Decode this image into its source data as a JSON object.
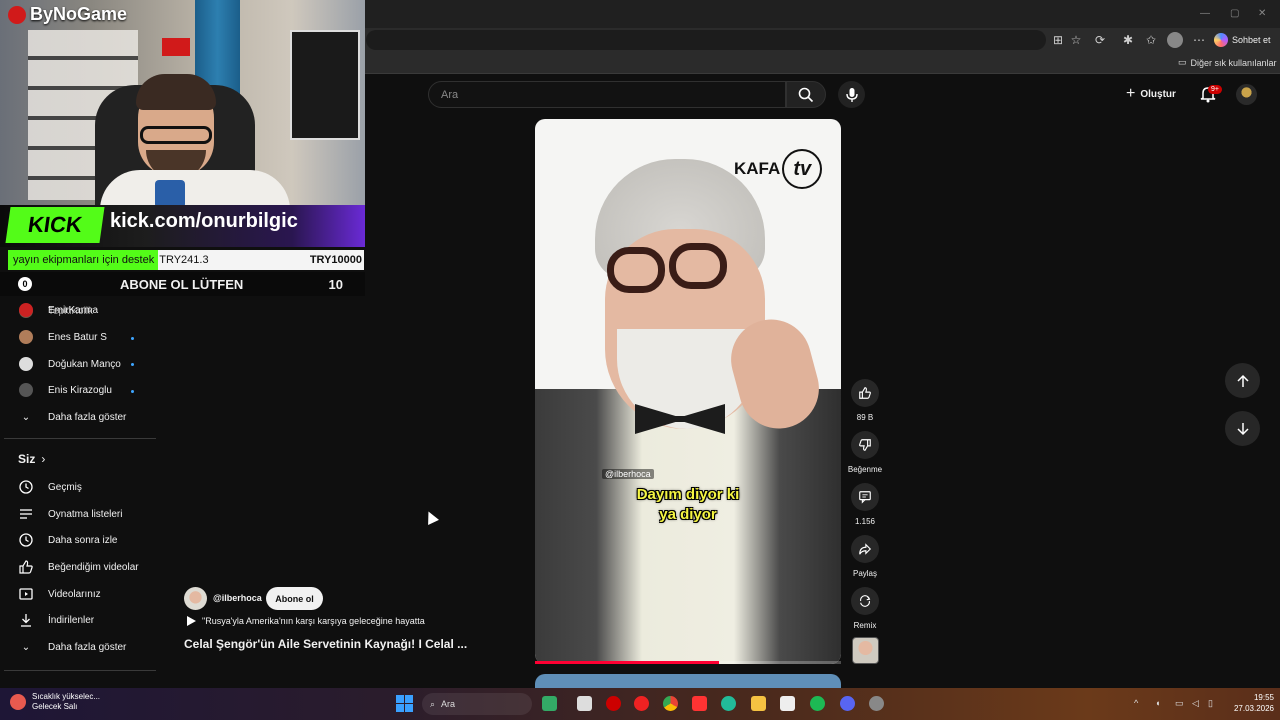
{
  "browser": {
    "sohbet_label": "Sohbet et",
    "other_bookmarks": "Diğer sık kullanılanlar",
    "toolbar_icons": [
      "apps-icon",
      "star-icon",
      "refresh-icon",
      "extensions-icon",
      "favorites-icon",
      "profile-icon",
      "more-icon"
    ]
  },
  "header": {
    "search_placeholder": "Ara",
    "create_label": "Oluştur",
    "notification_badge": "9+"
  },
  "overlay": {
    "brand": "ByNoGame",
    "kick_logo": "KICK",
    "kick_url": "kick.com/onurbilgic",
    "donation_text": "yayın ekipmanları için destek",
    "donation_current": "TRY241.3",
    "donation_goal": "TRY10000",
    "donation_progress": 0.024,
    "abone_text": "ABONE OL LÜTFEN",
    "abone_count": "10",
    "accent_color": "#53fc18"
  },
  "sidebar": {
    "channels": [
      {
        "name": "TepkiKolik",
        "live": false
      },
      {
        "name": "EmirKarma",
        "live": false
      },
      {
        "name": "Enes Batur S",
        "live": true
      },
      {
        "name": "Doğukan Manço",
        "live": true
      },
      {
        "name": "Enis Kirazoglu",
        "live": true
      }
    ],
    "show_more": "Daha fazla göster",
    "you_section": "Siz",
    "you_items": [
      {
        "label": "Geçmiş",
        "icon": "history-icon"
      },
      {
        "label": "Oynatma listeleri",
        "icon": "playlist-icon"
      },
      {
        "label": "Daha sonra izle",
        "icon": "watch-later-icon"
      },
      {
        "label": "Beğendiğim videolar",
        "icon": "liked-icon"
      },
      {
        "label": "Videolarınız",
        "icon": "your-videos-icon"
      },
      {
        "label": "İndirilenler",
        "icon": "download-icon"
      }
    ],
    "show_more_2": "Daha fazla göster"
  },
  "short": {
    "logo_text": "KAFA",
    "logo_tv": "tv",
    "handle_overlay": "@ilberhoca",
    "caption_line1": "Dayım diyor ki",
    "caption_line2": "ya diyor",
    "progress": 0.6
  },
  "actions": {
    "like_count": "89 B",
    "dislike_label": "Beğenme",
    "comment_count": "1.156",
    "share_label": "Paylaş",
    "remix_label": "Remix"
  },
  "channel": {
    "handle": "@ilberhoca",
    "subscribe_label": "Abone ol",
    "song": "\"Rusya'yla Amerika'nın karşı karşıya geleceğine hayatta",
    "title": "Celal Şengör'ün Aile Servetinin Kaynağı! I Celal ..."
  },
  "taskbar": {
    "weather_line1": "Sıcaklık yükselec...",
    "weather_line2": "Gelecek Salı",
    "search_label": "Ara",
    "time": "19:55",
    "date": "27.03.2026"
  }
}
